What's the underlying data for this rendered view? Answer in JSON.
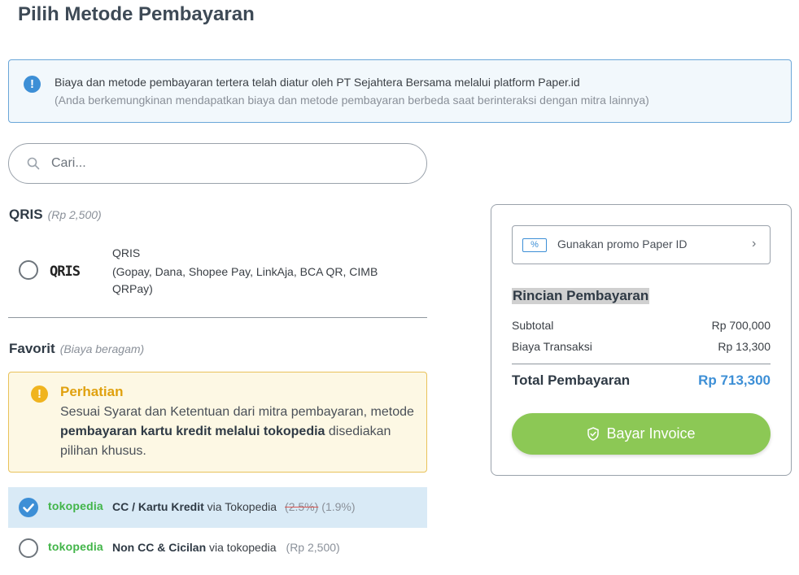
{
  "page": {
    "title": "Pilih Metode Pembayaran"
  },
  "info": {
    "line1": "Biaya dan metode pembayaran tertera telah diatur oleh PT Sejahtera Bersama melalui platform Paper.id",
    "line2": "(Anda berkemungkinan mendapatkan biaya dan metode pembayaran berbeda saat berinteraksi dengan mitra lainnya)"
  },
  "search": {
    "placeholder": "Cari..."
  },
  "qris_section": {
    "title": "QRIS",
    "fee": "(Rp 2,500)",
    "logo_text": "QRIS",
    "option_name": "QRIS",
    "option_desc": "(Gopay, Dana, Shopee Pay, LinkAja, BCA QR, CIMB QRPay)"
  },
  "favorit_section": {
    "title": "Favorit",
    "fee": "(Biaya beragam)"
  },
  "warning": {
    "title": "Perhatian",
    "text_1": "Sesuai Syarat dan Ketentuan dari mitra pembayaran, metode ",
    "text_bold": "pembayaran kartu kredit melalui tokopedia",
    "text_2": " disediakan pilihan khusus."
  },
  "payment_options": [
    {
      "logo": "tokopedia",
      "name": "CC / Kartu Kredit",
      "via": " via Tokopedia",
      "old_fee": "(2.5%)",
      "fee": "(1.9%)",
      "selected": true
    },
    {
      "logo": "tokopedia",
      "name": "Non CC & Cicilan",
      "via": " via tokopedia",
      "fee": "(Rp 2,500)",
      "selected": false
    }
  ],
  "summary": {
    "promo_icon": "%",
    "promo_label": "Gunakan promo Paper ID",
    "title": "Rincian Pembayaran",
    "rows": [
      {
        "label": "Subtotal",
        "value": "Rp 700,000"
      },
      {
        "label": "Biaya Transaksi",
        "value": "Rp 13,300"
      }
    ],
    "total_label": "Total Pembayaran",
    "total_value": "Rp 713,300",
    "button_label": "Bayar Invoice"
  },
  "colors": {
    "accent": "#3d8fd6",
    "button": "#8cc855",
    "warning": "#f0b41f",
    "tokopedia": "#42b549"
  }
}
